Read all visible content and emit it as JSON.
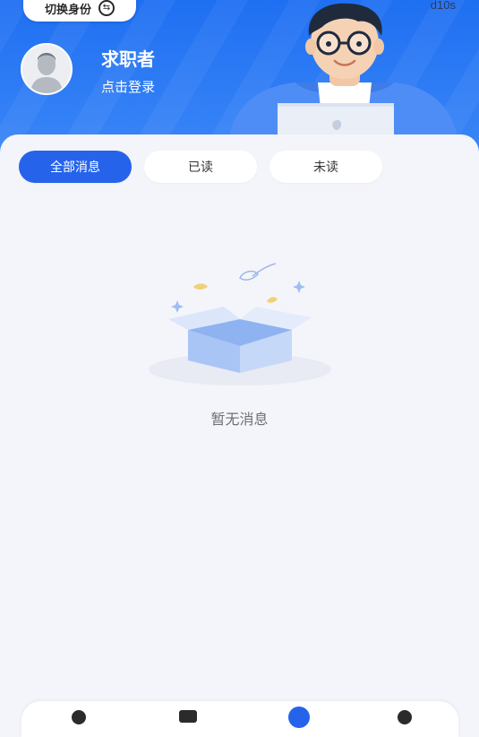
{
  "header": {
    "switch_identity_label": "切换身份",
    "version_text": "d10s",
    "user_role": "求职者",
    "login_prompt": "点击登录",
    "brand_color": "#2563eb"
  },
  "tabs": [
    {
      "label": "全部消息",
      "active": true
    },
    {
      "label": "已读",
      "active": false
    },
    {
      "label": "未读",
      "active": false
    }
  ],
  "empty_state": {
    "message": "暂无消息",
    "icon": "empty-box-icon"
  },
  "bottom_nav": {
    "icons": [
      "home-icon",
      "job-icon",
      "message-icon",
      "profile-icon"
    ]
  }
}
